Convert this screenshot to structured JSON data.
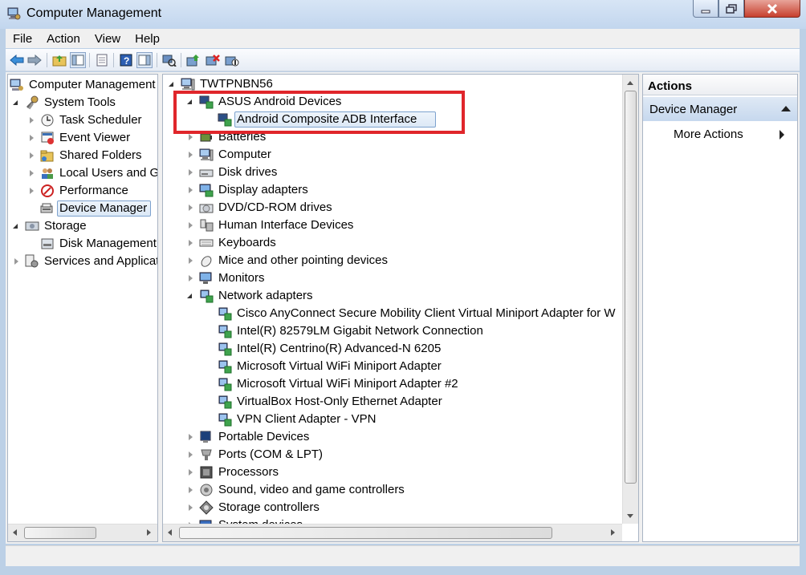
{
  "window": {
    "title": "Computer Management"
  },
  "menu": [
    "File",
    "Action",
    "View",
    "Help"
  ],
  "toolbar_icons": [
    "back-arrow-icon",
    "forward-arrow-icon",
    "up-folder-icon",
    "show-hide-console-tree-icon",
    "properties-icon",
    "help-icon",
    "show-hide-action-pane-icon",
    "scan-hardware-icon",
    "update-driver-icon",
    "uninstall-icon",
    "disable-device-icon"
  ],
  "left_tree": [
    {
      "label": "Computer Management",
      "level": 0,
      "icon": "computer-management-icon",
      "state": "none"
    },
    {
      "label": "System Tools",
      "level": 1,
      "icon": "tools-icon",
      "state": "expanded"
    },
    {
      "label": "Task Scheduler",
      "level": 2,
      "icon": "clock-icon",
      "state": "collapsed"
    },
    {
      "label": "Event Viewer",
      "level": 2,
      "icon": "event-viewer-icon",
      "state": "collapsed"
    },
    {
      "label": "Shared Folders",
      "level": 2,
      "icon": "shared-folder-icon",
      "state": "collapsed"
    },
    {
      "label": "Local Users and Gro",
      "level": 2,
      "icon": "users-icon",
      "state": "collapsed"
    },
    {
      "label": "Performance",
      "level": 2,
      "icon": "performance-icon",
      "state": "collapsed"
    },
    {
      "label": "Device Manager",
      "level": 2,
      "icon": "device-manager-icon",
      "state": "none",
      "selected": true
    },
    {
      "label": "Storage",
      "level": 1,
      "icon": "storage-icon",
      "state": "expanded"
    },
    {
      "label": "Disk Management",
      "level": 2,
      "icon": "disk-management-icon",
      "state": "none"
    },
    {
      "label": "Services and Applicat",
      "level": 1,
      "icon": "services-icon",
      "state": "collapsed"
    }
  ],
  "center_tree": [
    {
      "label": "TWTPNBN56",
      "level": 0,
      "icon": "computer-icon",
      "state": "expanded"
    },
    {
      "label": "ASUS Android Devices",
      "level": 1,
      "icon": "android-devices-icon",
      "state": "expanded"
    },
    {
      "label": "Android Composite ADB Interface",
      "level": 2,
      "icon": "adb-interface-icon",
      "state": "none",
      "selected": true
    },
    {
      "label": "Batteries",
      "level": 1,
      "icon": "battery-icon",
      "state": "collapsed"
    },
    {
      "label": "Computer",
      "level": 1,
      "icon": "computer-icon",
      "state": "collapsed"
    },
    {
      "label": "Disk drives",
      "level": 1,
      "icon": "disk-drive-icon",
      "state": "collapsed"
    },
    {
      "label": "Display adapters",
      "level": 1,
      "icon": "display-adapter-icon",
      "state": "collapsed"
    },
    {
      "label": "DVD/CD-ROM drives",
      "level": 1,
      "icon": "dvd-drive-icon",
      "state": "collapsed"
    },
    {
      "label": "Human Interface Devices",
      "level": 1,
      "icon": "hid-icon",
      "state": "collapsed"
    },
    {
      "label": "Keyboards",
      "level": 1,
      "icon": "keyboard-icon",
      "state": "collapsed"
    },
    {
      "label": "Mice and other pointing devices",
      "level": 1,
      "icon": "mouse-icon",
      "state": "collapsed"
    },
    {
      "label": "Monitors",
      "level": 1,
      "icon": "monitor-icon",
      "state": "collapsed"
    },
    {
      "label": "Network adapters",
      "level": 1,
      "icon": "network-adapter-icon",
      "state": "expanded"
    },
    {
      "label": "Cisco AnyConnect Secure Mobility Client Virtual Miniport Adapter for W",
      "level": 2,
      "icon": "network-adapter-icon",
      "state": "none"
    },
    {
      "label": "Intel(R) 82579LM Gigabit Network Connection",
      "level": 2,
      "icon": "network-adapter-icon",
      "state": "none"
    },
    {
      "label": "Intel(R) Centrino(R) Advanced-N 6205",
      "level": 2,
      "icon": "network-adapter-icon",
      "state": "none"
    },
    {
      "label": "Microsoft Virtual WiFi Miniport Adapter",
      "level": 2,
      "icon": "network-adapter-icon",
      "state": "none"
    },
    {
      "label": "Microsoft Virtual WiFi Miniport Adapter #2",
      "level": 2,
      "icon": "network-adapter-icon",
      "state": "none"
    },
    {
      "label": "VirtualBox Host-Only Ethernet Adapter",
      "level": 2,
      "icon": "network-adapter-icon",
      "state": "none"
    },
    {
      "label": "VPN Client Adapter - VPN",
      "level": 2,
      "icon": "network-adapter-icon",
      "state": "none"
    },
    {
      "label": "Portable Devices",
      "level": 1,
      "icon": "portable-device-icon",
      "state": "collapsed"
    },
    {
      "label": "Ports (COM & LPT)",
      "level": 1,
      "icon": "port-icon",
      "state": "collapsed"
    },
    {
      "label": "Processors",
      "level": 1,
      "icon": "processor-icon",
      "state": "collapsed"
    },
    {
      "label": "Sound, video and game controllers",
      "level": 1,
      "icon": "sound-icon",
      "state": "collapsed"
    },
    {
      "label": "Storage controllers",
      "level": 1,
      "icon": "storage-controller-icon",
      "state": "collapsed"
    },
    {
      "label": "System devices",
      "level": 1,
      "icon": "system-device-icon",
      "state": "collapsed"
    }
  ],
  "actions": {
    "header": "Actions",
    "section": "Device Manager",
    "more": "More Actions"
  },
  "colors": {
    "highlight": "#e0262b",
    "selection": "#dce8f6"
  }
}
